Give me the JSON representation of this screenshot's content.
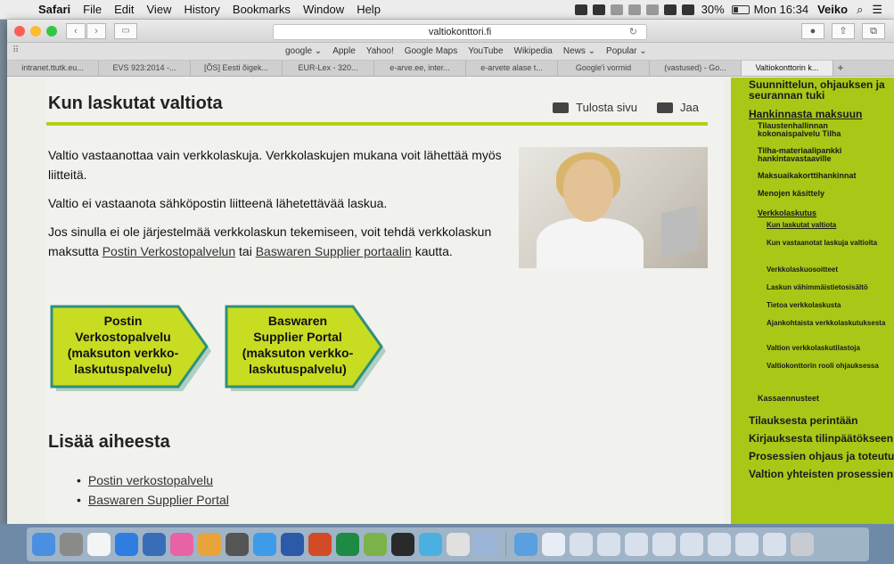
{
  "menubar": {
    "app": "Safari",
    "items": [
      "File",
      "Edit",
      "View",
      "History",
      "Bookmarks",
      "Window",
      "Help"
    ],
    "battery": "30%",
    "clock": "Mon 16:34",
    "user": "Veiko"
  },
  "browser": {
    "url": "valtiokonttori.fi",
    "favorites": [
      "google ⌄",
      "Apple",
      "Yahoo!",
      "Google Maps",
      "YouTube",
      "Wikipedia",
      "News ⌄",
      "Popular ⌄"
    ],
    "tabs": [
      "intranet.ttutk.eu...",
      "EVS 923:2014 -...",
      "[ÕS] Eesti õigek...",
      "EUR-Lex - 320...",
      "e-arve.ee, inter...",
      "e-arvete alase t...",
      "Google'i vormid",
      "(vastused) - Go...",
      "Valtiokonttorin k..."
    ]
  },
  "page": {
    "title": "Kun laskutat valtiota",
    "print_label": "Tulosta sivu",
    "share_label": "Jaa",
    "para1": "Valtio vastaanottaa vain verkkolaskuja. Verkkolaskujen mukana voit lähettää myös liitteitä.",
    "para2": "Valtio ei vastaanota sähköpostin liitteenä lähetettävää laskua.",
    "para3_a": "Jos sinulla ei ole järjestelmää verkkolaskun tekemiseen, voit tehdä verkkolaskun maksutta",
    "para3_link1": "Postin Verkostopalvelun",
    "para3_b": " tai ",
    "para3_link2": "Baswaren Supplier portaalin",
    "para3_c": "kautta.",
    "button1": [
      "Postin",
      "Verkostopalvelu",
      "(maksuton verkko-",
      "laskutuspalvelu)"
    ],
    "button2": [
      "Baswaren",
      "Supplier Portal",
      "(maksuton verkko-",
      "laskutuspalvelu)"
    ],
    "more_title": "Lisää aiheesta",
    "more_links": [
      "Postin verkostopalvelu",
      "Baswaren Supplier Portal"
    ]
  },
  "sidenav": {
    "top": "Suunnittelun, ohjauksen ja seurannan tuki",
    "head": "Hankinnasta maksuun",
    "items": [
      "Tilaustenhallinnan kokonaispalvelu Tilha",
      "Tilha-materiaalipankki hankintavastaaville",
      "Maksuaikakorttihankinnat",
      "Menojen käsittely",
      "Verkkolaskutus"
    ],
    "subitems": [
      "Kun laskutat valtiota",
      "Kun vastaanotat laskuja valtiolta",
      "Verkkolaskuosoitteet",
      "Laskun vähimmäistietosisältö",
      "Tietoa verkkolaskusta",
      "Ajankohtaista verkkolaskutuksesta",
      "Valtion verkkolaskutilastoja",
      "Valtiokonttorin rooli ohjauksessa"
    ],
    "kassa": "Kassaennusteet",
    "bottom": [
      "Tilauksesta perintään",
      "Kirjauksesta tilinpäätökseen",
      "Prosessien ohjaus ja toteutus",
      "Valtion yhteisten prosessien vastuunjaot"
    ]
  },
  "colors": {
    "accent": "#b7ce1a",
    "nav_bg": "#a8c818",
    "button_fill": "#c8dc22",
    "button_border": "#2f8f7a"
  }
}
